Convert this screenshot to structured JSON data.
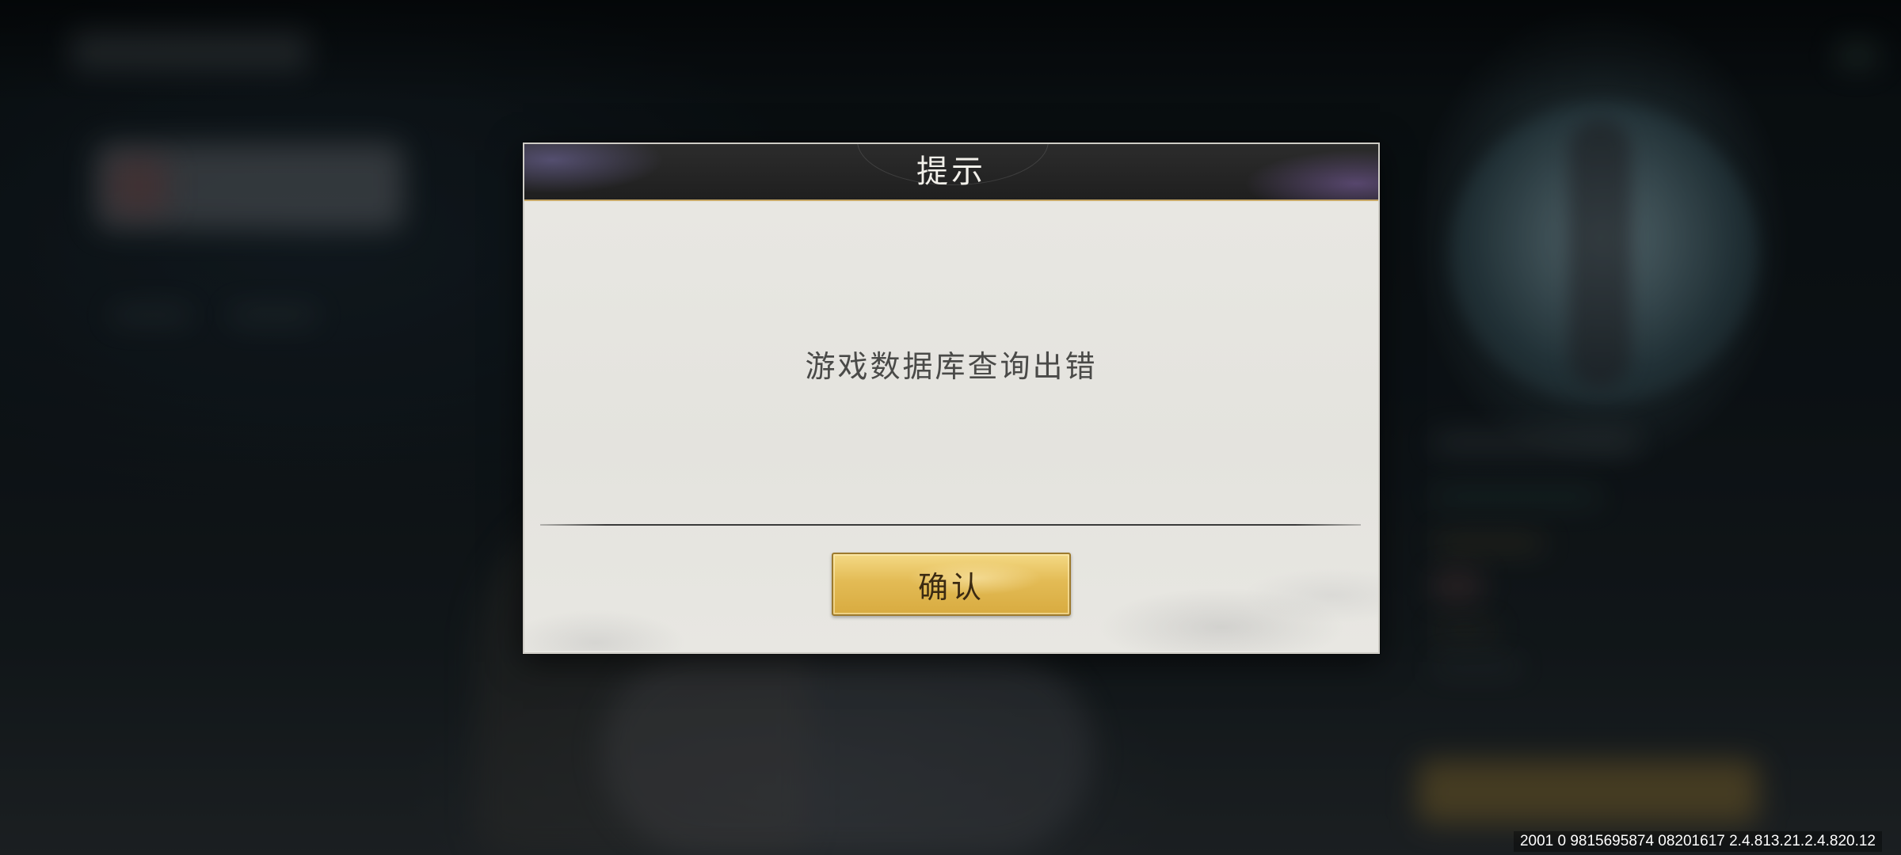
{
  "dialog": {
    "title": "提示",
    "message": "游戏数据库查询出错",
    "confirm_label": "确认"
  },
  "footer": {
    "version_text": "2001 0 9815695874 08201617 2.4.813.21.2.4.820.12"
  },
  "colors": {
    "button_gold": "#e3bb55",
    "header_dark": "#1f1f1f",
    "panel_bg": "#e6e5e0",
    "message_text": "#4a4a48"
  }
}
